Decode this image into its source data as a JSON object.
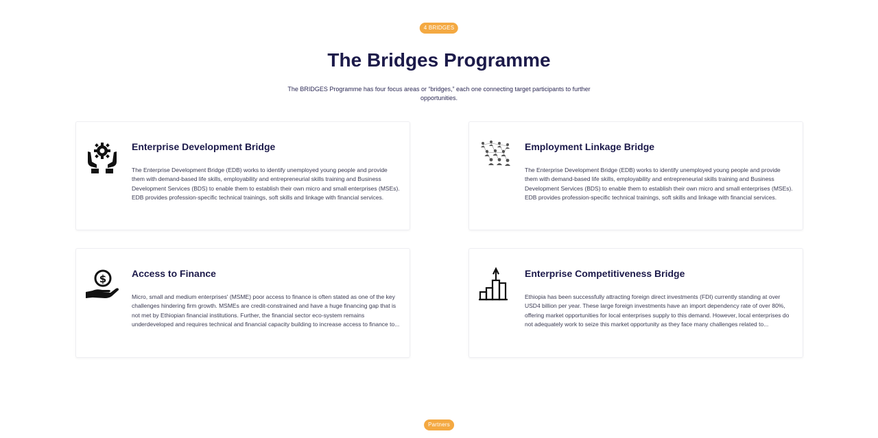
{
  "section": {
    "badge": "4 BRIDGES",
    "title": "The Bridges Programme",
    "subtitle": "The BRIDGES Programme has four focus areas or “bridges,” each one connecting target participants to further opportunities."
  },
  "cards": [
    {
      "icon": "hands-gear-icon",
      "title": "Enterprise Development Bridge",
      "text": "The Enterprise Development Bridge (EDB) works to identify unemployed young people and provide them with demand-based life skills, employability and entrepreneurial skills training and Business Development Services (BDS) to enable them to establish their own micro and small enterprises (MSEs). EDB provides profession-specific technical trainings, soft skills and linkage with financial services."
    },
    {
      "icon": "people-network-icon",
      "title": "Employment Linkage Bridge",
      "text": "The Enterprise Development Bridge (EDB) works to identify unemployed young people and provide them with demand-based life skills, employability and entrepreneurial skills training and Business Development Services (BDS) to enable them to establish their own micro and small enterprises (MSEs). EDB provides profession-specific technical trainings, soft skills and linkage with financial services."
    },
    {
      "icon": "hand-coin-icon",
      "title": "Access to Finance",
      "text": "Micro, small and medium enterprises' (MSME) poor access to finance is often stated as one of the key challenges hindering firm growth. MSMEs are credit-constrained and have a huge financing gap that is not met by Ethiopian financial institutions. Further, the financial sector eco-system remains underdeveloped and requires technical and financial capacity building to increase access to finance to..."
    },
    {
      "icon": "growth-bars-icon",
      "title": "Enterprise Competitiveness Bridge",
      "text": "Ethiopia has been successfully attracting foreign direct investments (FDI) currently standing at over USD4 billion per year. These large foreign investments have an import dependency rate of over 80%, offering market opportunities for local enterprises supply to this demand. However, local enterprises do not adequately work to seize this market opportunity as they face many challenges related to..."
    }
  ],
  "partners": {
    "badge": "Partners"
  },
  "colors": {
    "accent": "#f4a942",
    "heading": "#1c1a4a",
    "body_text": "#3a3a52",
    "card_border": "#eeeef2"
  }
}
